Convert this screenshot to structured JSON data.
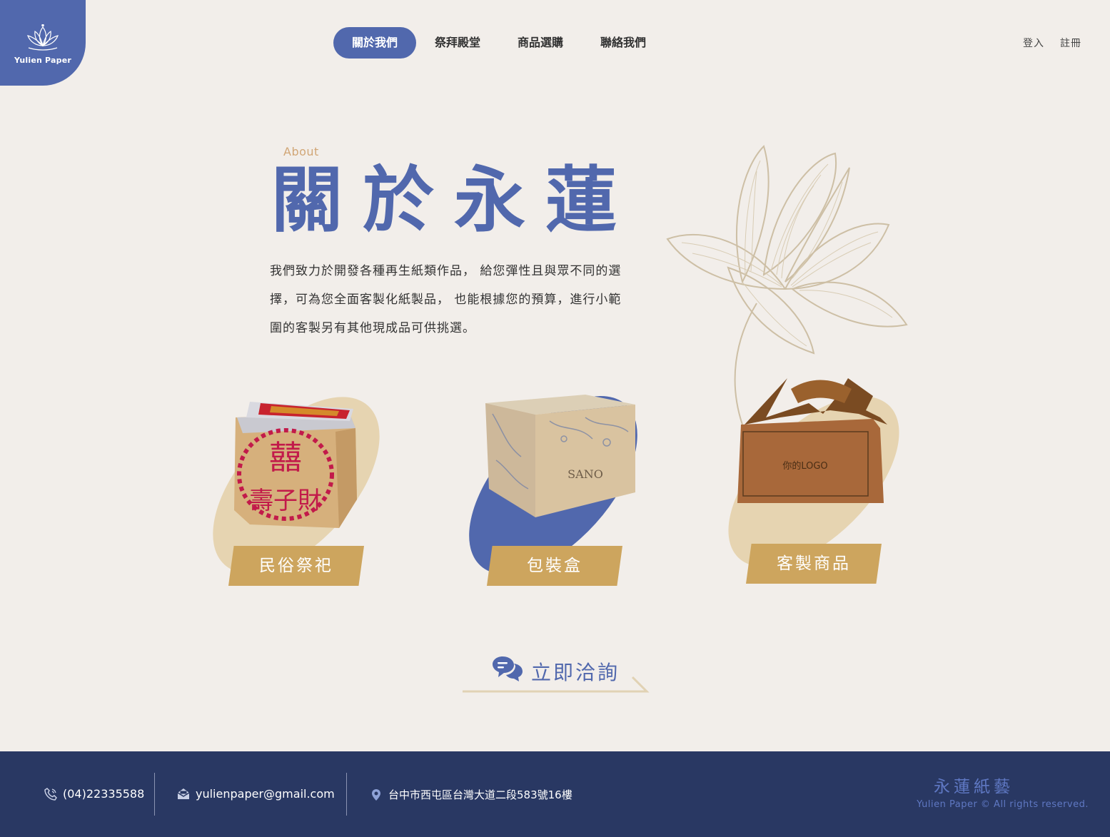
{
  "logo": {
    "text": "Yulien Paper",
    "icon": "lotus-icon"
  },
  "nav": {
    "items": [
      {
        "label": "關於我們",
        "active": true
      },
      {
        "label": "祭拜殿堂",
        "active": false
      },
      {
        "label": "商品選購",
        "active": false
      },
      {
        "label": "聯絡我們",
        "active": false
      }
    ]
  },
  "auth": {
    "login": "登入",
    "register": "註冊"
  },
  "about": {
    "label": "About",
    "title": "關於永蓮",
    "description": "我們致力於開發各種再生紙類作品， 給您彈性且與眾不同的選擇，可為您全面客製化紙製品， 也能根據您的預算，進行小範圍的客製另有其他現成品可供挑選。"
  },
  "categories": [
    {
      "label": "民俗祭祀",
      "blob_color": "#e6d4b1",
      "product": "paper-offering-stack",
      "printed": "囍 壽子財"
    },
    {
      "label": "包裝盒",
      "blob_color": "#5168ad",
      "product": "printed-kraft-box",
      "printed": "SANO"
    },
    {
      "label": "客製商品",
      "blob_color": "#e6d4b1",
      "product": "kraft-handle-box",
      "printed": "你的LOGO"
    }
  ],
  "cta": {
    "label": "立即洽詢",
    "icon": "chat-bubbles-icon"
  },
  "footer": {
    "phone": "(04)22335588",
    "email": "yulienpaper@gmail.com",
    "address": "台中市西屯區台灣大道二段583號16樓",
    "brand": "永蓮紙藝",
    "copyright": "Yulien Paper © All rights reserved."
  },
  "colors": {
    "primary": "#5168ad",
    "gold": "#cda55e",
    "sand": "#e6d4b1",
    "background": "#f2eeea",
    "footer": "#293863"
  }
}
